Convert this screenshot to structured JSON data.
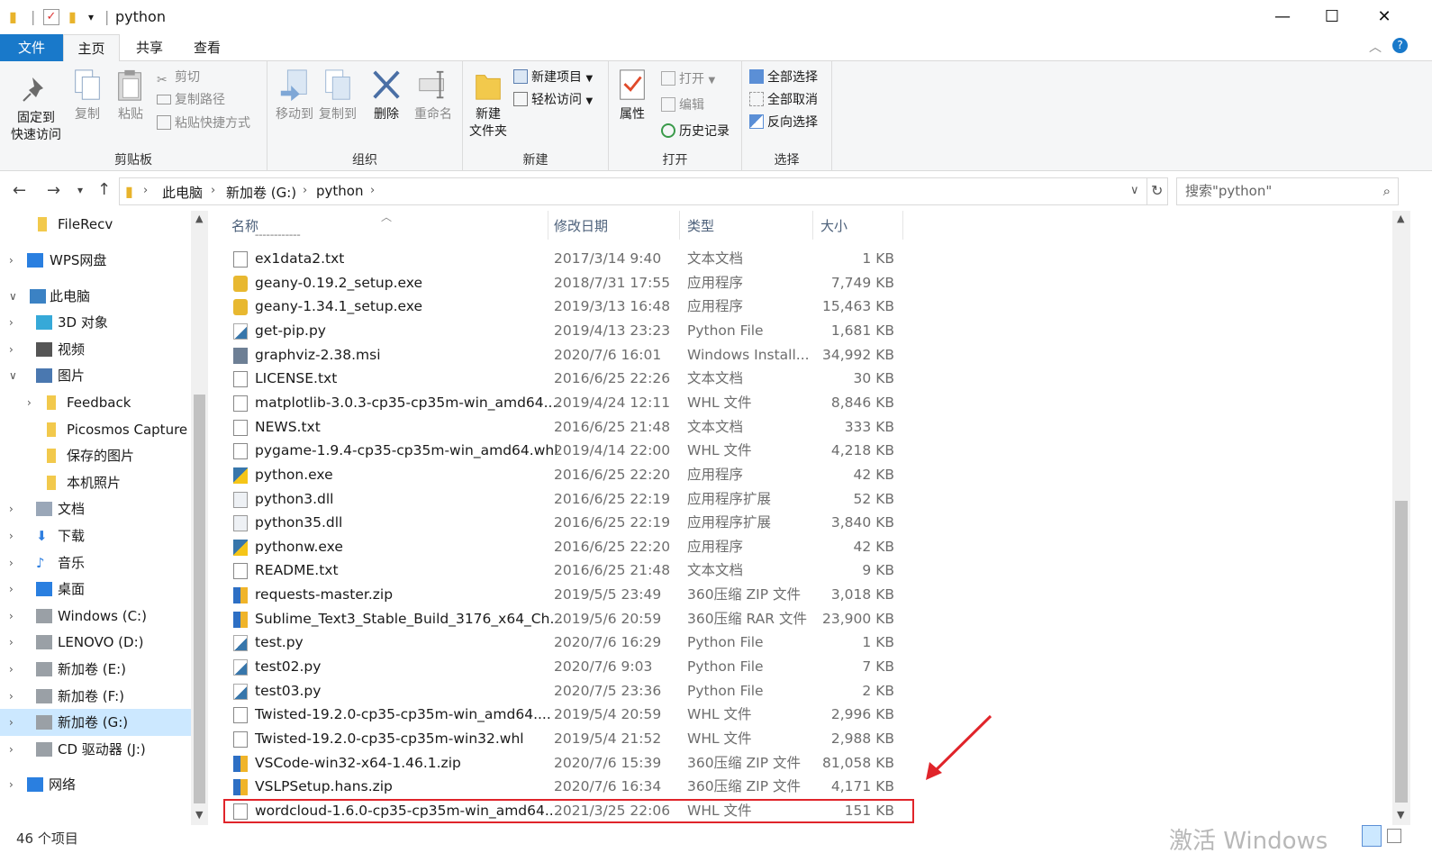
{
  "window": {
    "title": "python"
  },
  "menu_tabs": [
    "文件",
    "主页",
    "共享",
    "查看"
  ],
  "ribbon": {
    "groups": {
      "clipboard": "剪贴板",
      "organize": "组织",
      "new": "新建",
      "open": "打开",
      "select": "选择"
    },
    "pin_line1": "固定到",
    "pin_line2": "快速访问",
    "copy": "复制",
    "paste": "粘贴",
    "cut": "剪切",
    "copy_path": "复制路径",
    "paste_shortcut": "粘贴快捷方式",
    "move_to": "移动到",
    "copy_to": "复制到",
    "delete": "删除",
    "rename": "重命名",
    "new_folder_line1": "新建",
    "new_folder_line2": "文件夹",
    "new_item": "新建项目",
    "easy_access": "轻松访问",
    "properties": "属性",
    "open": "打开",
    "edit": "编辑",
    "history": "历史记录",
    "select_all": "全部选择",
    "select_none": "全部取消",
    "invert_selection": "反向选择"
  },
  "breadcrumb": [
    "此电脑",
    "新加卷 (G:)",
    "python"
  ],
  "search": {
    "placeholder": "搜索\"python\""
  },
  "nav": [
    {
      "label": "FileRecv",
      "icon": "folder-icon"
    },
    {
      "label": "WPS网盘",
      "icon": "cloud-icon"
    },
    {
      "label": "此电脑",
      "icon": "computer-icon"
    },
    {
      "label": "3D 对象",
      "icon": "cube-icon"
    },
    {
      "label": "视频",
      "icon": "video-icon"
    },
    {
      "label": "图片",
      "icon": "picture-icon"
    },
    {
      "label": "Feedback",
      "icon": "folder-icon"
    },
    {
      "label": "Picosmos Capture",
      "icon": "folder-icon"
    },
    {
      "label": "保存的图片",
      "icon": "folder-icon"
    },
    {
      "label": "本机照片",
      "icon": "folder-icon"
    },
    {
      "label": "文档",
      "icon": "document-icon"
    },
    {
      "label": "下载",
      "icon": "download-icon"
    },
    {
      "label": "音乐",
      "icon": "music-icon"
    },
    {
      "label": "桌面",
      "icon": "desktop-icon"
    },
    {
      "label": "Windows (C:)",
      "icon": "drive-icon"
    },
    {
      "label": "LENOVO (D:)",
      "icon": "drive-icon"
    },
    {
      "label": "新加卷 (E:)",
      "icon": "drive-icon"
    },
    {
      "label": "新加卷 (F:)",
      "icon": "drive-icon"
    },
    {
      "label": "新加卷 (G:)",
      "icon": "drive-icon"
    },
    {
      "label": "CD 驱动器 (J:)",
      "icon": "cd-drive-icon"
    },
    {
      "label": "网络",
      "icon": "network-icon"
    }
  ],
  "columns": {
    "name": "名称",
    "date": "修改日期",
    "type": "类型",
    "size": "大小"
  },
  "files": [
    {
      "name": "ex1data2.txt",
      "date": "2017/3/14 9:40",
      "type": "文本文档",
      "size": "1 KB",
      "icon": "text-file-icon"
    },
    {
      "name": "geany-0.19.2_setup.exe",
      "date": "2018/7/31 17:55",
      "type": "应用程序",
      "size": "7,749 KB",
      "icon": "installer-icon"
    },
    {
      "name": "geany-1.34.1_setup.exe",
      "date": "2019/3/13 16:48",
      "type": "应用程序",
      "size": "15,463 KB",
      "icon": "installer-icon"
    },
    {
      "name": "get-pip.py",
      "date": "2019/4/13 23:23",
      "type": "Python File",
      "size": "1,681 KB",
      "icon": "python-file-icon"
    },
    {
      "name": "graphviz-2.38.msi",
      "date": "2020/7/6 16:01",
      "type": "Windows Install...",
      "size": "34,992 KB",
      "icon": "msi-icon"
    },
    {
      "name": "LICENSE.txt",
      "date": "2016/6/25 22:26",
      "type": "文本文档",
      "size": "30 KB",
      "icon": "text-file-icon"
    },
    {
      "name": "matplotlib-3.0.3-cp35-cp35m-win_amd64....",
      "date": "2019/4/24 12:11",
      "type": "WHL 文件",
      "size": "8,846 KB",
      "icon": "blank-file-icon"
    },
    {
      "name": "NEWS.txt",
      "date": "2016/6/25 21:48",
      "type": "文本文档",
      "size": "333 KB",
      "icon": "text-file-icon"
    },
    {
      "name": "pygame-1.9.4-cp35-cp35m-win_amd64.whl",
      "date": "2019/4/14 22:00",
      "type": "WHL 文件",
      "size": "4,218 KB",
      "icon": "blank-file-icon"
    },
    {
      "name": "python.exe",
      "date": "2016/6/25 22:20",
      "type": "应用程序",
      "size": "42 KB",
      "icon": "python-exe-icon"
    },
    {
      "name": "python3.dll",
      "date": "2016/6/25 22:19",
      "type": "应用程序扩展",
      "size": "52 KB",
      "icon": "dll-icon"
    },
    {
      "name": "python35.dll",
      "date": "2016/6/25 22:19",
      "type": "应用程序扩展",
      "size": "3,840 KB",
      "icon": "dll-icon"
    },
    {
      "name": "pythonw.exe",
      "date": "2016/6/25 22:20",
      "type": "应用程序",
      "size": "42 KB",
      "icon": "python-exe-icon"
    },
    {
      "name": "README.txt",
      "date": "2016/6/25 21:48",
      "type": "文本文档",
      "size": "9 KB",
      "icon": "text-file-icon"
    },
    {
      "name": "requests-master.zip",
      "date": "2019/5/5 23:49",
      "type": "360压缩 ZIP 文件",
      "size": "3,018 KB",
      "icon": "archive-icon"
    },
    {
      "name": "Sublime_Text3_Stable_Build_3176_x64_Ch...",
      "date": "2019/5/6 20:59",
      "type": "360压缩 RAR 文件",
      "size": "23,900 KB",
      "icon": "archive-icon"
    },
    {
      "name": "test.py",
      "date": "2020/7/6 16:29",
      "type": "Python File",
      "size": "1 KB",
      "icon": "python-file-icon"
    },
    {
      "name": "test02.py",
      "date": "2020/7/6 9:03",
      "type": "Python File",
      "size": "7 KB",
      "icon": "python-file-icon"
    },
    {
      "name": "test03.py",
      "date": "2020/7/5 23:36",
      "type": "Python File",
      "size": "2 KB",
      "icon": "python-file-icon"
    },
    {
      "name": "Twisted-19.2.0-cp35-cp35m-win_amd64....",
      "date": "2019/5/4 20:59",
      "type": "WHL 文件",
      "size": "2,996 KB",
      "icon": "blank-file-icon"
    },
    {
      "name": "Twisted-19.2.0-cp35-cp35m-win32.whl",
      "date": "2019/5/4 21:52",
      "type": "WHL 文件",
      "size": "2,988 KB",
      "icon": "blank-file-icon"
    },
    {
      "name": "VSCode-win32-x64-1.46.1.zip",
      "date": "2020/7/6 15:39",
      "type": "360压缩 ZIP 文件",
      "size": "81,058 KB",
      "icon": "archive-icon"
    },
    {
      "name": "VSLPSetup.hans.zip",
      "date": "2020/7/6 16:34",
      "type": "360压缩 ZIP 文件",
      "size": "4,171 KB",
      "icon": "archive-icon"
    },
    {
      "name": "wordcloud-1.6.0-cp35-cp35m-win_amd64....",
      "date": "2021/3/25 22:06",
      "type": "WHL 文件",
      "size": "151 KB",
      "icon": "blank-file-icon"
    }
  ],
  "status": {
    "item_count": "46 个项目"
  },
  "watermark": "激活 Windows",
  "colors": {
    "accent": "#1979ca",
    "selection": "#cce8ff",
    "highlight_box": "#e0242a",
    "arrow": "#e0242a"
  }
}
